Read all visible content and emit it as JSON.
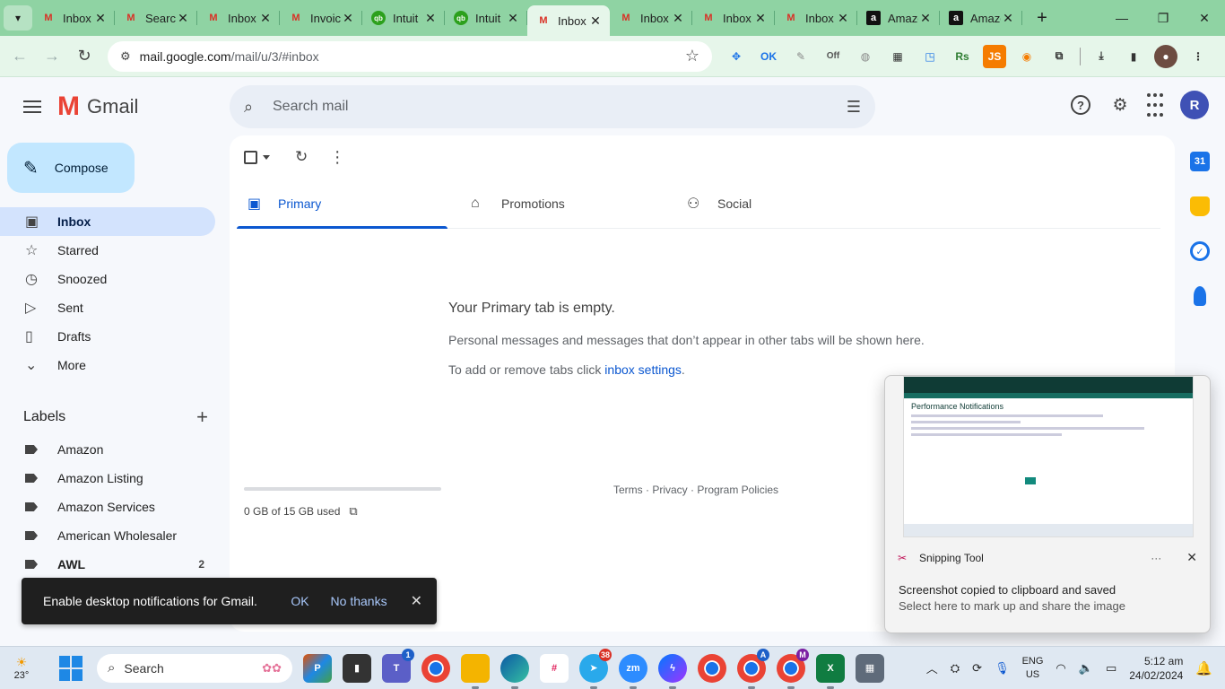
{
  "browser": {
    "tabs": [
      {
        "title": "Inbox",
        "icon": "gmail"
      },
      {
        "title": "Search",
        "icon": "gmail"
      },
      {
        "title": "Inbox",
        "icon": "gmail"
      },
      {
        "title": "Invoice",
        "icon": "gmail"
      },
      {
        "title": "Intuit",
        "icon": "intuit"
      },
      {
        "title": "Intuit",
        "icon": "intuit"
      },
      {
        "title": "Inbox",
        "icon": "gmail",
        "active": true
      },
      {
        "title": "Inbox",
        "icon": "gmail"
      },
      {
        "title": "Inbox",
        "icon": "gmail"
      },
      {
        "title": "Inbox",
        "icon": "gmail"
      },
      {
        "title": "Amazon",
        "icon": "amazon"
      },
      {
        "title": "Amazon",
        "icon": "amazon"
      }
    ],
    "url_host": "mail.google.com",
    "url_path": "/mail/u/3/#inbox",
    "tabstrip_color": "#8fd3a3"
  },
  "gmail": {
    "logo_text": "Gmail",
    "search_placeholder": "Search mail",
    "avatar_letter": "R",
    "compose_label": "Compose",
    "nav": [
      {
        "label": "Inbox",
        "icon": "inbox-icon",
        "active": true
      },
      {
        "label": "Starred",
        "icon": "star-icon"
      },
      {
        "label": "Snoozed",
        "icon": "clock-icon"
      },
      {
        "label": "Sent",
        "icon": "send-icon"
      },
      {
        "label": "Drafts",
        "icon": "draft-icon"
      },
      {
        "label": "More",
        "icon": "chevron-down-icon"
      }
    ],
    "labels_title": "Labels",
    "labels": [
      {
        "name": "Amazon",
        "count": ""
      },
      {
        "name": "Amazon Listing",
        "count": ""
      },
      {
        "name": "Amazon Services",
        "count": ""
      },
      {
        "name": "American Wholesaler",
        "count": ""
      },
      {
        "name": "AWL",
        "count": "2",
        "bold": true
      }
    ],
    "tabs": [
      {
        "label": "Primary",
        "icon": "inbox-icon",
        "active": true
      },
      {
        "label": "Promotions",
        "icon": "tag-icon"
      },
      {
        "label": "Social",
        "icon": "people-icon"
      }
    ],
    "empty_title": "Your Primary tab is empty.",
    "empty_desc": "Personal messages and messages that don’t appear in other tabs will be shown here.",
    "empty_link_prefix": "To add or remove tabs click ",
    "empty_link": "inbox settings",
    "empty_link_suffix": ".",
    "storage_text": "0 GB of 15 GB used",
    "storage_used_fraction": 0.0,
    "footer_links": "Terms · Privacy · Program Policies",
    "accent_color": "#0b57d0"
  },
  "toast": {
    "message": "Enable desktop notifications for Gmail.",
    "ok": "OK",
    "no_thanks": "No thanks"
  },
  "snip": {
    "app_name": "Snipping Tool",
    "message": "Screenshot copied to clipboard and saved",
    "sub": "Select here to mark up and share the image",
    "thumb_title": "Performance Notifications"
  },
  "taskbar": {
    "temperature": "23°",
    "search_label": "Search",
    "teams_badge": "1",
    "telegram_badge": "38",
    "chrome_profiles": [
      "A",
      "M"
    ],
    "lang_top": "ENG",
    "lang_bottom": "US",
    "time": "5:12 am",
    "date": "24/02/2024"
  }
}
